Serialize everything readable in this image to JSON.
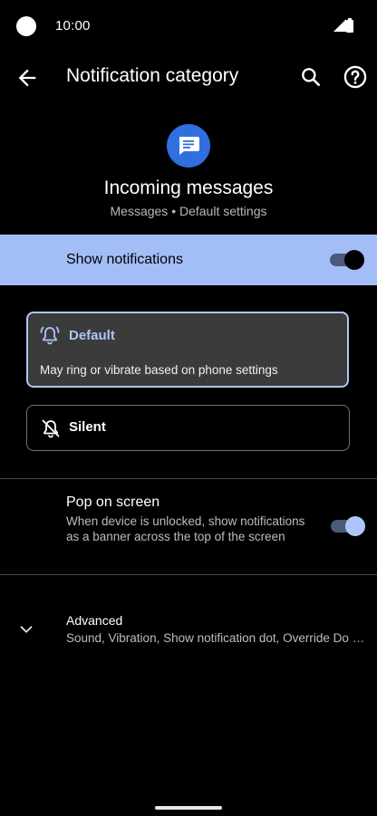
{
  "status_bar": {
    "time": "10:00"
  },
  "app_bar": {
    "title": "Notification category"
  },
  "header": {
    "category_title": "Incoming messages",
    "subtitle": "Messages • Default settings",
    "icon_color": "#2f6fde"
  },
  "show_notifications": {
    "label": "Show notifications",
    "enabled": true
  },
  "options": {
    "default": {
      "label": "Default",
      "description": "May ring or vibrate based on phone settings",
      "selected": true
    },
    "silent": {
      "label": "Silent",
      "selected": false
    }
  },
  "pop_on_screen": {
    "title": "Pop on screen",
    "description": "When device is unlocked, show notifications as a banner across the top of the screen",
    "enabled": true
  },
  "advanced": {
    "title": "Advanced",
    "description": "Sound, Vibration, Show notification dot, Override Do Not Disturb"
  },
  "colors": {
    "accent": "#aec5fa",
    "highlight_row": "#a3bdf7",
    "card_bg": "#3b3b3b"
  }
}
